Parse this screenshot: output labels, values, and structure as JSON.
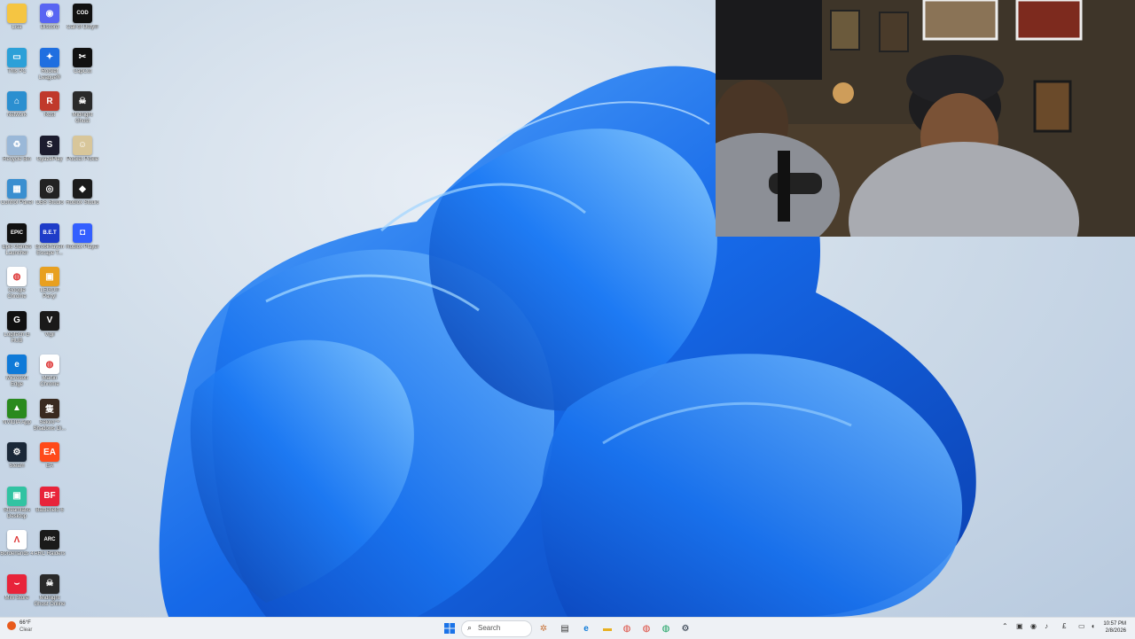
{
  "desktop": {
    "icons": [
      {
        "label": "Lisa",
        "icon": "folder-icon",
        "color": "#f5c542",
        "glyph": ""
      },
      {
        "label": "Discord",
        "icon": "discord-icon",
        "color": "#5865f2",
        "glyph": "◉"
      },
      {
        "label": "Call of Duty®",
        "icon": "call-of-duty-icon",
        "color": "#111111",
        "glyph": "COD"
      },
      {
        "label": "This PC",
        "icon": "computer-icon",
        "color": "#2ba0d8",
        "glyph": "▭"
      },
      {
        "label": "Rocket League®",
        "icon": "rocket-league-icon",
        "color": "#1f6fe0",
        "glyph": "✦"
      },
      {
        "label": "CapCut",
        "icon": "capcut-icon",
        "color": "#111111",
        "glyph": "✂"
      },
      {
        "label": "Network",
        "icon": "network-icon",
        "color": "#2b8fd0",
        "glyph": "⌂"
      },
      {
        "label": "Rust",
        "icon": "rust-icon",
        "color": "#c0392b",
        "glyph": "R"
      },
      {
        "label": "Midnight Ghost",
        "icon": "midnight-ghost-icon",
        "color": "#2a2a2a",
        "glyph": "☠"
      },
      {
        "label": "Recycle Bin",
        "icon": "recycle-bin-icon",
        "color": "#9ab8d8",
        "glyph": "♻"
      },
      {
        "label": "GyazePlay",
        "icon": "gyaze-icon",
        "color": "#1c1c2e",
        "glyph": "S"
      },
      {
        "label": "Pocket Pickle",
        "icon": "pocket-pickle-icon",
        "color": "#d8c69a",
        "glyph": "☺"
      },
      {
        "label": "Control Panel",
        "icon": "control-panel-icon",
        "color": "#3a8fd0",
        "glyph": "▦"
      },
      {
        "label": "OBS Studio",
        "icon": "obs-icon",
        "color": "#222222",
        "glyph": "◎"
      },
      {
        "label": "Roblox Studio",
        "icon": "roblox-studio-icon",
        "color": "#1b1b1b",
        "glyph": "◆"
      },
      {
        "label": "Epic Games Launcher",
        "icon": "epic-games-icon",
        "color": "#111111",
        "glyph": "EPIC"
      },
      {
        "label": "Brookhaven Escape T...",
        "icon": "bet-icon",
        "color": "#1e3cc8",
        "glyph": "B.E.T"
      },
      {
        "label": "Roblox Player",
        "icon": "roblox-player-icon",
        "color": "#335fff",
        "glyph": "◘"
      },
      {
        "label": "Google Chrome",
        "icon": "chrome-icon",
        "color": "#ffffff",
        "glyph": "◍"
      },
      {
        "label": "LEGO® Party!",
        "icon": "lego-party-icon",
        "color": "#e8a020",
        "glyph": "▣"
      },
      {
        "label": "Logitech G HUB",
        "icon": "logitech-icon",
        "color": "#111111",
        "glyph": "G"
      },
      {
        "label": "Vigil",
        "icon": "vigil-icon",
        "color": "#1a1a1a",
        "glyph": "V"
      },
      {
        "label": "Microsoft Edge",
        "icon": "edge-icon",
        "color": "#0f7ad8",
        "glyph": "e"
      },
      {
        "label": "Martin Chrome",
        "icon": "chrome-profile-icon",
        "color": "#ffffff",
        "glyph": "◍"
      },
      {
        "label": "NVIDIA App",
        "icon": "nvidia-icon",
        "color": "#2a8a1e",
        "glyph": "▲"
      },
      {
        "label": "Sekiro™ Shadows Di...",
        "icon": "sekiro-icon",
        "color": "#3a2a20",
        "glyph": "隻"
      },
      {
        "label": "Steam",
        "icon": "steam-icon",
        "color": "#1b2838",
        "glyph": "⚙"
      },
      {
        "label": "EA",
        "icon": "ea-icon",
        "color": "#ff4a1a",
        "glyph": "EA"
      },
      {
        "label": "Streamlabs Desktop",
        "icon": "streamlabs-icon",
        "color": "#31c3a2",
        "glyph": "▣"
      },
      {
        "label": "Battlefield 6",
        "icon": "battlefield-icon",
        "color": "#e8243a",
        "glyph": "BF"
      },
      {
        "label": "Borderlands 4",
        "icon": "borderlands-icon",
        "color": "#ffffff",
        "glyph": "Λ"
      },
      {
        "label": "ARC Raiders",
        "icon": "arc-raiders-icon",
        "color": "#1a1a1a",
        "glyph": "ARC"
      },
      {
        "label": "Mini Store",
        "icon": "mini-store-icon",
        "color": "#e8243a",
        "glyph": "⌣"
      },
      {
        "label": "Midnight Ghost Online",
        "icon": "midnight-ghost-online-icon",
        "color": "#2a2a2a",
        "glyph": "☠"
      }
    ]
  },
  "webcam": {
    "overlay": "webcam-feed"
  },
  "taskbar": {
    "weather": {
      "temp": "66°F",
      "condition": "Clear"
    },
    "search_placeholder": "Search",
    "pinned": [
      {
        "name": "start-button",
        "icon": "windows-logo-icon"
      },
      {
        "name": "copilot-button",
        "icon": "copilot-icon"
      },
      {
        "name": "task-view-button",
        "icon": "task-view-icon"
      },
      {
        "name": "edge-taskbar",
        "icon": "edge-icon"
      },
      {
        "name": "file-explorer-taskbar",
        "icon": "folder-icon"
      },
      {
        "name": "chrome-taskbar",
        "icon": "chrome-icon"
      },
      {
        "name": "chrome-profile-taskbar",
        "icon": "chrome-profile-icon"
      },
      {
        "name": "chrome-profile2-taskbar",
        "icon": "chrome-profile-icon"
      },
      {
        "name": "steam-taskbar",
        "icon": "steam-icon"
      }
    ],
    "clock": {
      "time": "10:57 PM",
      "date": "2/8/2026"
    }
  }
}
